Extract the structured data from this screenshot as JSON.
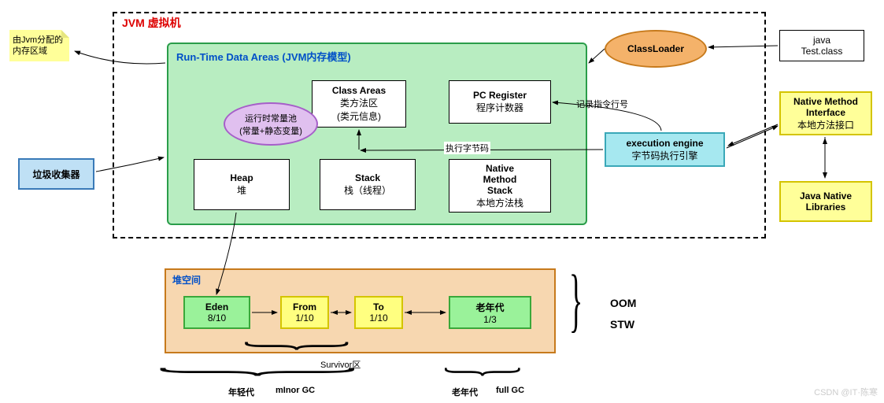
{
  "note": {
    "text": "由Jvm分配的内存区域"
  },
  "jvm": {
    "title": "JVM 虚拟机"
  },
  "rtda": {
    "title": "Run-Time Data Areas    (JVM内存模型)"
  },
  "classAreas": {
    "l1": "Class Areas",
    "l2": "类方法区",
    "l3": "(类元信息)"
  },
  "pool": {
    "l1": "运行时常量池",
    "l2": "(常量+静态变量)"
  },
  "pc": {
    "l1": "PC Register",
    "l2": "程序计数器"
  },
  "heap": {
    "l1": "Heap",
    "l2": "堆"
  },
  "stack": {
    "l1": "Stack",
    "l2": "栈（线程）"
  },
  "nstack": {
    "l1": "Native",
    "l2": "Method",
    "l3": "Stack",
    "l4": "本地方法栈"
  },
  "classloader": {
    "text": "ClassLoader"
  },
  "exec": {
    "l1": "execution engine",
    "l2": "字节码执行引擎"
  },
  "nativeIf": {
    "l1": "Native Method",
    "l2": "Interface",
    "l3": "本地方法接口"
  },
  "nativeLib": {
    "l1": "Java Native",
    "l2": "Libraries"
  },
  "javaClass": {
    "l1": "java",
    "l2": "Test.class"
  },
  "gc": {
    "text": "垃圾收集器"
  },
  "labels": {
    "recordLine": "记录指令行号",
    "execByte": "执行字节码"
  },
  "heapSpace": {
    "title": "堆空间"
  },
  "eden": {
    "l1": "Eden",
    "l2": "8/10"
  },
  "from": {
    "l1": "From",
    "l2": "1/10"
  },
  "to": {
    "l1": "To",
    "l2": "1/10"
  },
  "oldGen": {
    "l1": "老年代",
    "l2": "1/3"
  },
  "survivor": {
    "text": "Survivor区"
  },
  "young": {
    "l1": "年轻代",
    "l2": "mInor GC"
  },
  "oldGc": {
    "l1": "老年代",
    "l2": "full GC"
  },
  "oom": {
    "text": "OOM"
  },
  "stw": {
    "text": "STW"
  },
  "watermark": {
    "text": "CSDN @IT·陈寒"
  }
}
